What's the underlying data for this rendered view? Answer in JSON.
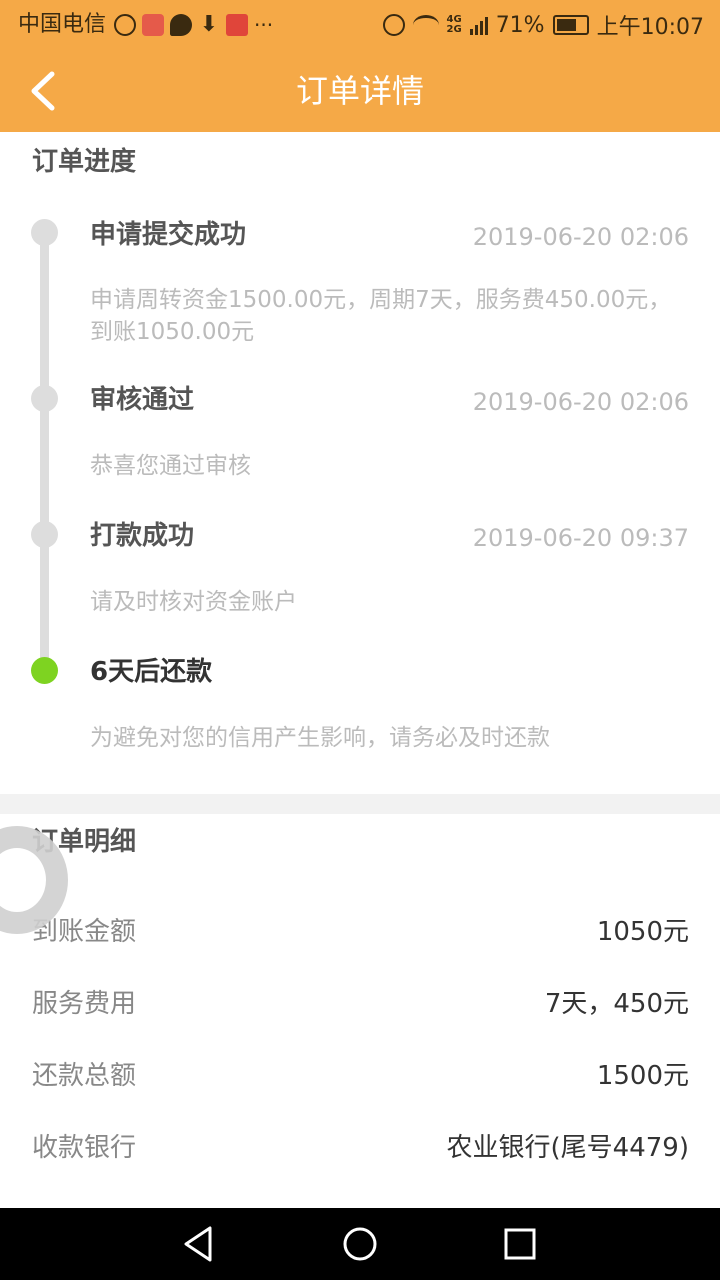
{
  "status_bar": {
    "carrier": "中国电信",
    "battery": "71%",
    "time": "上午10:07",
    "network_top": "4G",
    "network_bottom": "2G",
    "battery_level": 0.71
  },
  "header": {
    "title": "订单详情"
  },
  "progress": {
    "title": "订单进度",
    "steps": [
      {
        "title": "申请提交成功",
        "time": "2019-06-20 02:06",
        "desc": "申请周转资金1500.00元，周期7天，服务费450.00元，到账1050.00元",
        "active": false
      },
      {
        "title": "审核通过",
        "time": "2019-06-20 02:06",
        "desc": "恭喜您通过审核",
        "active": false
      },
      {
        "title": "打款成功",
        "time": "2019-06-20 09:37",
        "desc": "请及时核对资金账户",
        "active": false
      },
      {
        "title": "6天后还款",
        "time": "",
        "desc": "为避免对您的信用产生影响，请务必及时还款",
        "active": true
      }
    ]
  },
  "detail": {
    "title": "订单明细",
    "rows": [
      {
        "label": "到账金额",
        "value": "1050元"
      },
      {
        "label": "服务费用",
        "value": "7天，450元"
      },
      {
        "label": "还款总额",
        "value": "1500元"
      },
      {
        "label": "收款银行",
        "value": "农业银行(尾号4479)"
      }
    ]
  },
  "colors": {
    "accent": "#f5a947",
    "active_dot": "#7ed321",
    "timeline_gray": "#dddddd"
  },
  "icons": [
    "back-arrow-icon",
    "alarm-icon",
    "wifi-icon",
    "signal-icon",
    "battery-icon",
    "nav-back-icon",
    "nav-home-icon",
    "nav-recent-icon"
  ]
}
